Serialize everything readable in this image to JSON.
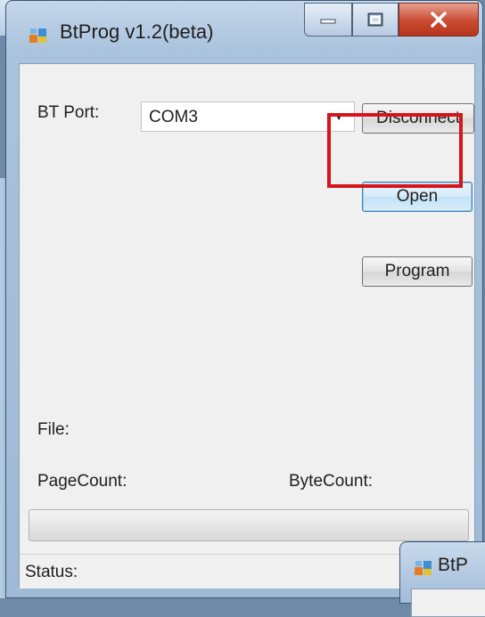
{
  "window": {
    "title": "BtProg v1.2(beta)",
    "icon": "app-window-icon",
    "caption_buttons": [
      "minimize-icon",
      "maximize-icon",
      "close-icon"
    ]
  },
  "form": {
    "bt_port_label": "BT Port:",
    "bt_port_selected": "COM3",
    "disconnect_label": "Disconnect",
    "open_label": "Open",
    "program_label": "Program",
    "file_label": "File:",
    "pagecount_label": "PageCount:",
    "bytecount_label": "ByteCount:",
    "status_label": "Status:"
  },
  "progress": {
    "value": 0
  },
  "highlight": {
    "color": "#d6141b",
    "target": "Open"
  },
  "overlap_window": {
    "title": "BtP"
  }
}
